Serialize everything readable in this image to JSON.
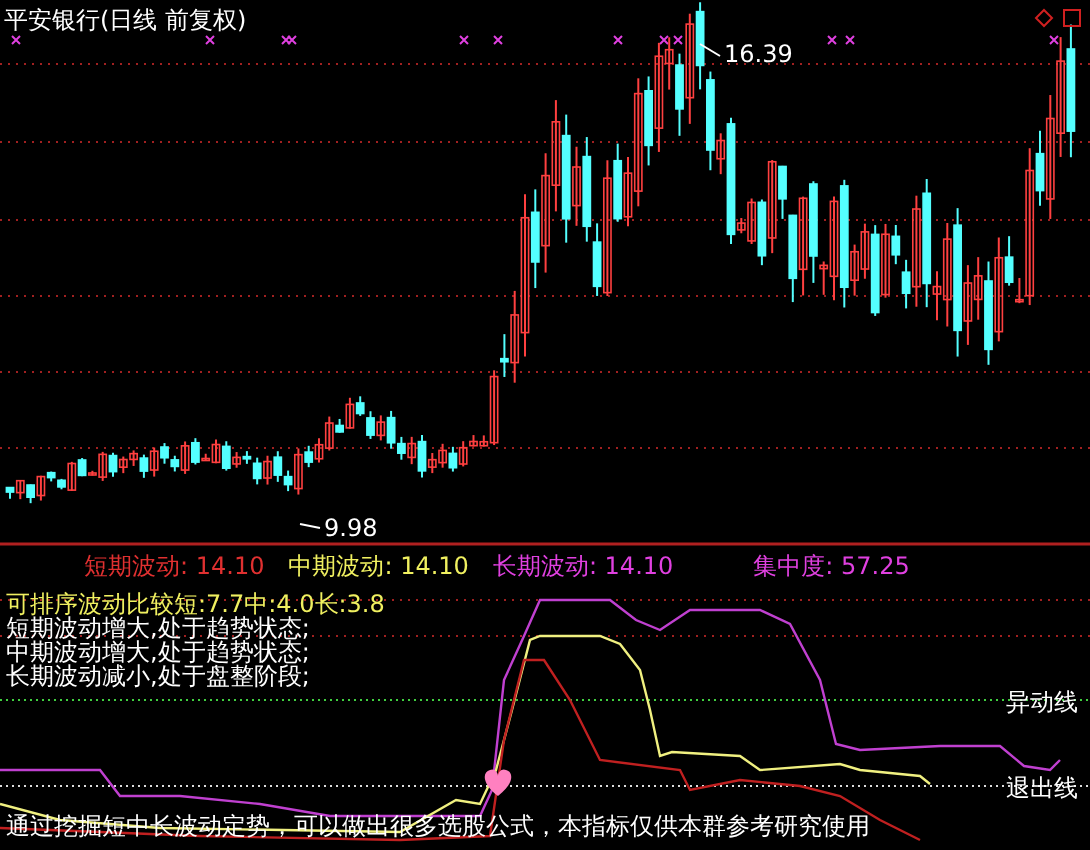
{
  "chart": {
    "title": "平安银行(日线 前复权)",
    "high_label": "16.39",
    "low_label": "9.98"
  },
  "indicator": {
    "readings": [
      {
        "text": "短期波动: 14.10",
        "color": "#e03030"
      },
      {
        "text": "中期波动: 14.10",
        "color": "#f0f060"
      },
      {
        "text": "长期波动: 14.10",
        "color": "#e040e0"
      },
      {
        "text": "集中度: 57.25",
        "color": "#e040e0"
      }
    ],
    "notes": [
      {
        "text": "可排序波动比较短:7.7中:4.0长:3.8",
        "color": "#f0f060"
      },
      {
        "text": "短期波动增大,处于趋势状态;",
        "color": "#ffffff"
      },
      {
        "text": "中期波动增大,处于趋势状态;",
        "color": "#ffffff"
      },
      {
        "text": "长期波动减小,处于盘整阶段;",
        "color": "#ffffff"
      }
    ]
  },
  "reference_lines": [
    "异动线",
    "退出线"
  ],
  "footer": "通过挖掘短中长波动定势，可以做出很多选股公式，本指标仅供本群参考研究使用"
}
